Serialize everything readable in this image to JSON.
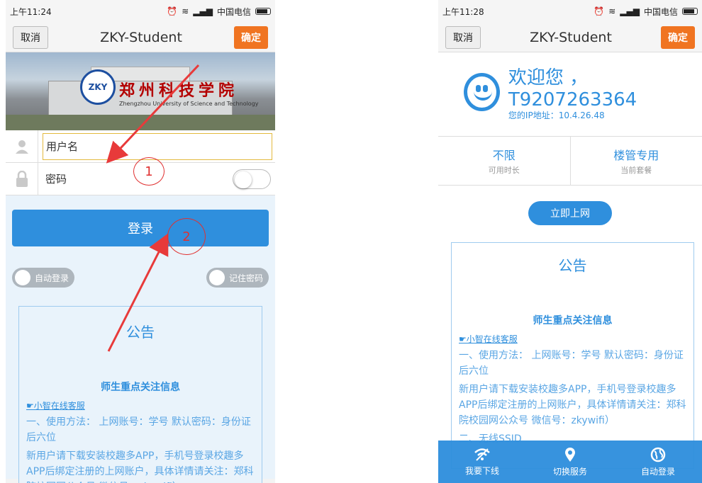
{
  "left": {
    "status": {
      "time": "上午11:24",
      "carrier": "中国电信"
    },
    "nav": {
      "cancel": "取消",
      "title": "ZKY-Student",
      "confirm": "确定"
    },
    "banner": {
      "school_name": "郑州科技学院",
      "school_name_en": "Zhengzhou University of Science and Technology",
      "logo_text": "ZKY"
    },
    "form": {
      "username_placeholder": "用户名",
      "password_label": "密码"
    },
    "login_button": "登录",
    "switches": {
      "auto_login": "自动登录",
      "remember_password": "记住密码"
    },
    "notice": {
      "title": "公告",
      "subtitle": "师生重点关注信息",
      "service": "☛小智在线客服",
      "line1": "一、使用方法：  上网账号：学号        默认密码：身份证后六位",
      "line2": "新用户请下载安装校趣多APP，手机号登录校趣多APP后绑定注册的上网账户，具体详情请关注：郑科院校园网公众号 微信号：zkywifi）"
    },
    "annotations": {
      "one": "1",
      "two": "2"
    }
  },
  "right": {
    "status": {
      "time": "上午11:28",
      "carrier": "中国电信"
    },
    "nav": {
      "cancel": "取消",
      "title": "ZKY-Student",
      "confirm": "确定"
    },
    "welcome": {
      "greeting": "欢迎您  ，T9207263364",
      "ip": "您的IP地址：10.4.26.48"
    },
    "stats": [
      {
        "value": "不限",
        "label": "可用时长"
      },
      {
        "value": "楼管专用",
        "label": "当前套餐"
      }
    ],
    "connect_button": "立即上网",
    "notice": {
      "title": "公告",
      "subtitle": "师生重点关注信息",
      "service": "☛小智在线客服",
      "line1": "一、使用方法：  上网账号：学号        默认密码：身份证后六位",
      "line2": "新用户请下载安装校趣多APP，手机号登录校趣多APP后绑定注册的上网账户，具体详情请关注：郑科院校园网公众号 微信号：zkywifi）",
      "line3": "二、无线SSID"
    },
    "bottom_nav": [
      {
        "label": "我要下线",
        "icon": "wifi-off-icon"
      },
      {
        "label": "切换服务",
        "icon": "location-pin-icon"
      },
      {
        "label": "自动登录",
        "icon": "globe-icon"
      }
    ]
  },
  "colors": {
    "accent": "#2f8fdd",
    "confirm": "#f07421",
    "annotation": "#e03030"
  }
}
